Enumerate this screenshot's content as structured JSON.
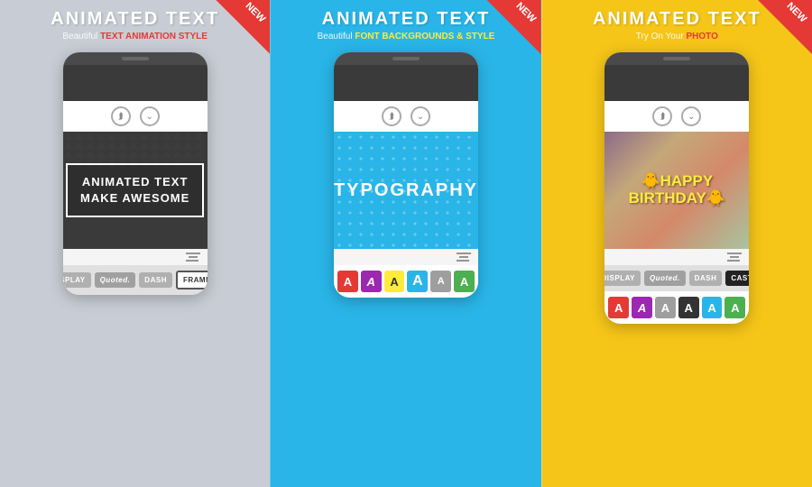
{
  "panels": [
    {
      "id": "panel-1",
      "bg": "#c5c9d2",
      "title": "ANIMATED TEXT",
      "subtitle_plain": "Beautiful ",
      "subtitle_highlight": "TEXT ANIMATION STYLE",
      "highlight_color": "#e53935",
      "phone_content_type": "text_box",
      "animated_text_line1": "ANIMATED TEXT",
      "animated_text_line2": "MAKE AWESOME",
      "style_options": [
        "DISPLAY",
        "Quoted.",
        "DASH",
        "FRAMED"
      ],
      "active_style": "FRAMED"
    },
    {
      "id": "panel-2",
      "bg": "#29b5e8",
      "title": "ANIMATED TEXT",
      "subtitle_plain": "Beautiful ",
      "subtitle_highlight": "FONT BACKGROUNDS & STYLE",
      "highlight_color": "#ffeb3b",
      "phone_content_type": "typography",
      "typography_text": "TYPOGRAPHY",
      "font_letters": [
        "A",
        "A",
        "A",
        "A",
        "A",
        "A"
      ],
      "font_colors": [
        "#e53935",
        "#9c27b0",
        "#ffeb3b",
        "#29b5e8",
        "#555",
        "#4caf50"
      ],
      "active_font": 3
    },
    {
      "id": "panel-3",
      "bg": "#f5c518",
      "title": "ANIMATED TEXT",
      "subtitle_plain": "Try On Your ",
      "subtitle_highlight": "PHOTO",
      "highlight_color": "#e53935",
      "phone_content_type": "birthday",
      "birthday_line1": "🐥HAPPY",
      "birthday_line2": "BIRTHDAY🐥",
      "style_options": [
        "DISPLAY",
        "Quoted.",
        "DASH",
        "CAST"
      ],
      "active_style": "CAST",
      "font_letters": [
        "A",
        "A",
        "A",
        "A",
        "A",
        "A"
      ],
      "font_colors": [
        "#e53935",
        "#9c27b0",
        "#555",
        "#333",
        "#29b5e8",
        "#4caf50"
      ],
      "active_font": 3
    }
  ],
  "new_badge": "NEW"
}
